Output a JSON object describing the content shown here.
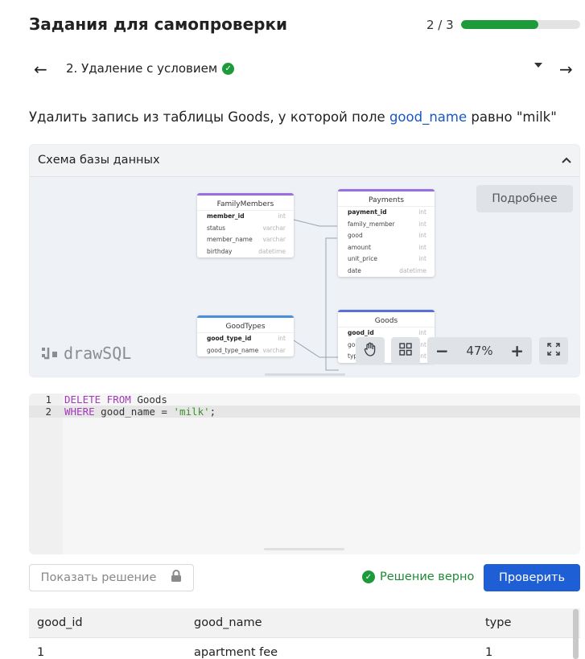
{
  "header": {
    "title": "Задания для самопроверки",
    "progress_text": "2 / 3",
    "progress_fraction": 0.65
  },
  "task_nav": {
    "back_arrow": "←",
    "forward_arrow": "→",
    "task_title": "2. Удаление с условием",
    "completed_icon": "check-circle-icon"
  },
  "task": {
    "text_before": "Удалить запись из таблицы Goods, у которой поле ",
    "field": "good_name",
    "text_after": " равно \"milk\""
  },
  "schema": {
    "title": "Схема базы данных",
    "more_button": "Подробнее",
    "logo_text": "drawSQL",
    "zoom": "47%",
    "tables": [
      {
        "name": "FamilyMembers",
        "color": "#9a6ee0",
        "rows": [
          {
            "name": "member_id",
            "type": "int",
            "pk": true
          },
          {
            "name": "status",
            "type": "varchar",
            "pk": false
          },
          {
            "name": "member_name",
            "type": "varchar",
            "pk": false
          },
          {
            "name": "birthday",
            "type": "datetime",
            "pk": false
          }
        ]
      },
      {
        "name": "Payments",
        "color": "#9a6ee0",
        "rows": [
          {
            "name": "payment_id",
            "type": "int",
            "pk": true
          },
          {
            "name": "family_member",
            "type": "int",
            "pk": false
          },
          {
            "name": "good",
            "type": "int",
            "pk": false
          },
          {
            "name": "amount",
            "type": "int",
            "pk": false
          },
          {
            "name": "unit_price",
            "type": "int",
            "pk": false
          },
          {
            "name": "date",
            "type": "datetime",
            "pk": false
          }
        ]
      },
      {
        "name": "GoodTypes",
        "color": "#4a90d9",
        "rows": [
          {
            "name": "good_type_id",
            "type": "int",
            "pk": true
          },
          {
            "name": "good_type_name",
            "type": "varchar",
            "pk": false
          }
        ]
      },
      {
        "name": "Goods",
        "color": "#5a6fd8",
        "rows": [
          {
            "name": "good_id",
            "type": "int",
            "pk": true
          },
          {
            "name": "good_name",
            "type": "int",
            "pk": false
          },
          {
            "name": "type",
            "type": "int",
            "pk": false
          }
        ]
      }
    ]
  },
  "editor": {
    "lines": [
      {
        "number": "1",
        "kw1": "DELETE FROM",
        "rest": " Goods",
        "str": "",
        "end": ""
      },
      {
        "number": "2",
        "kw1": "WHERE",
        "rest": " good_name = ",
        "str": "'milk'",
        "end": ";"
      }
    ]
  },
  "actions": {
    "show_solution": "Показать решение",
    "status_text": "Решение верно",
    "check_button": "Проверить"
  },
  "results": {
    "columns": [
      "good_id",
      "good_name",
      "type"
    ],
    "rows": [
      [
        "1",
        "apartment fee",
        "1"
      ]
    ]
  },
  "colors": {
    "accent": "#1f5fd6",
    "success": "#1d9a3a",
    "link": "#1a56c9"
  }
}
